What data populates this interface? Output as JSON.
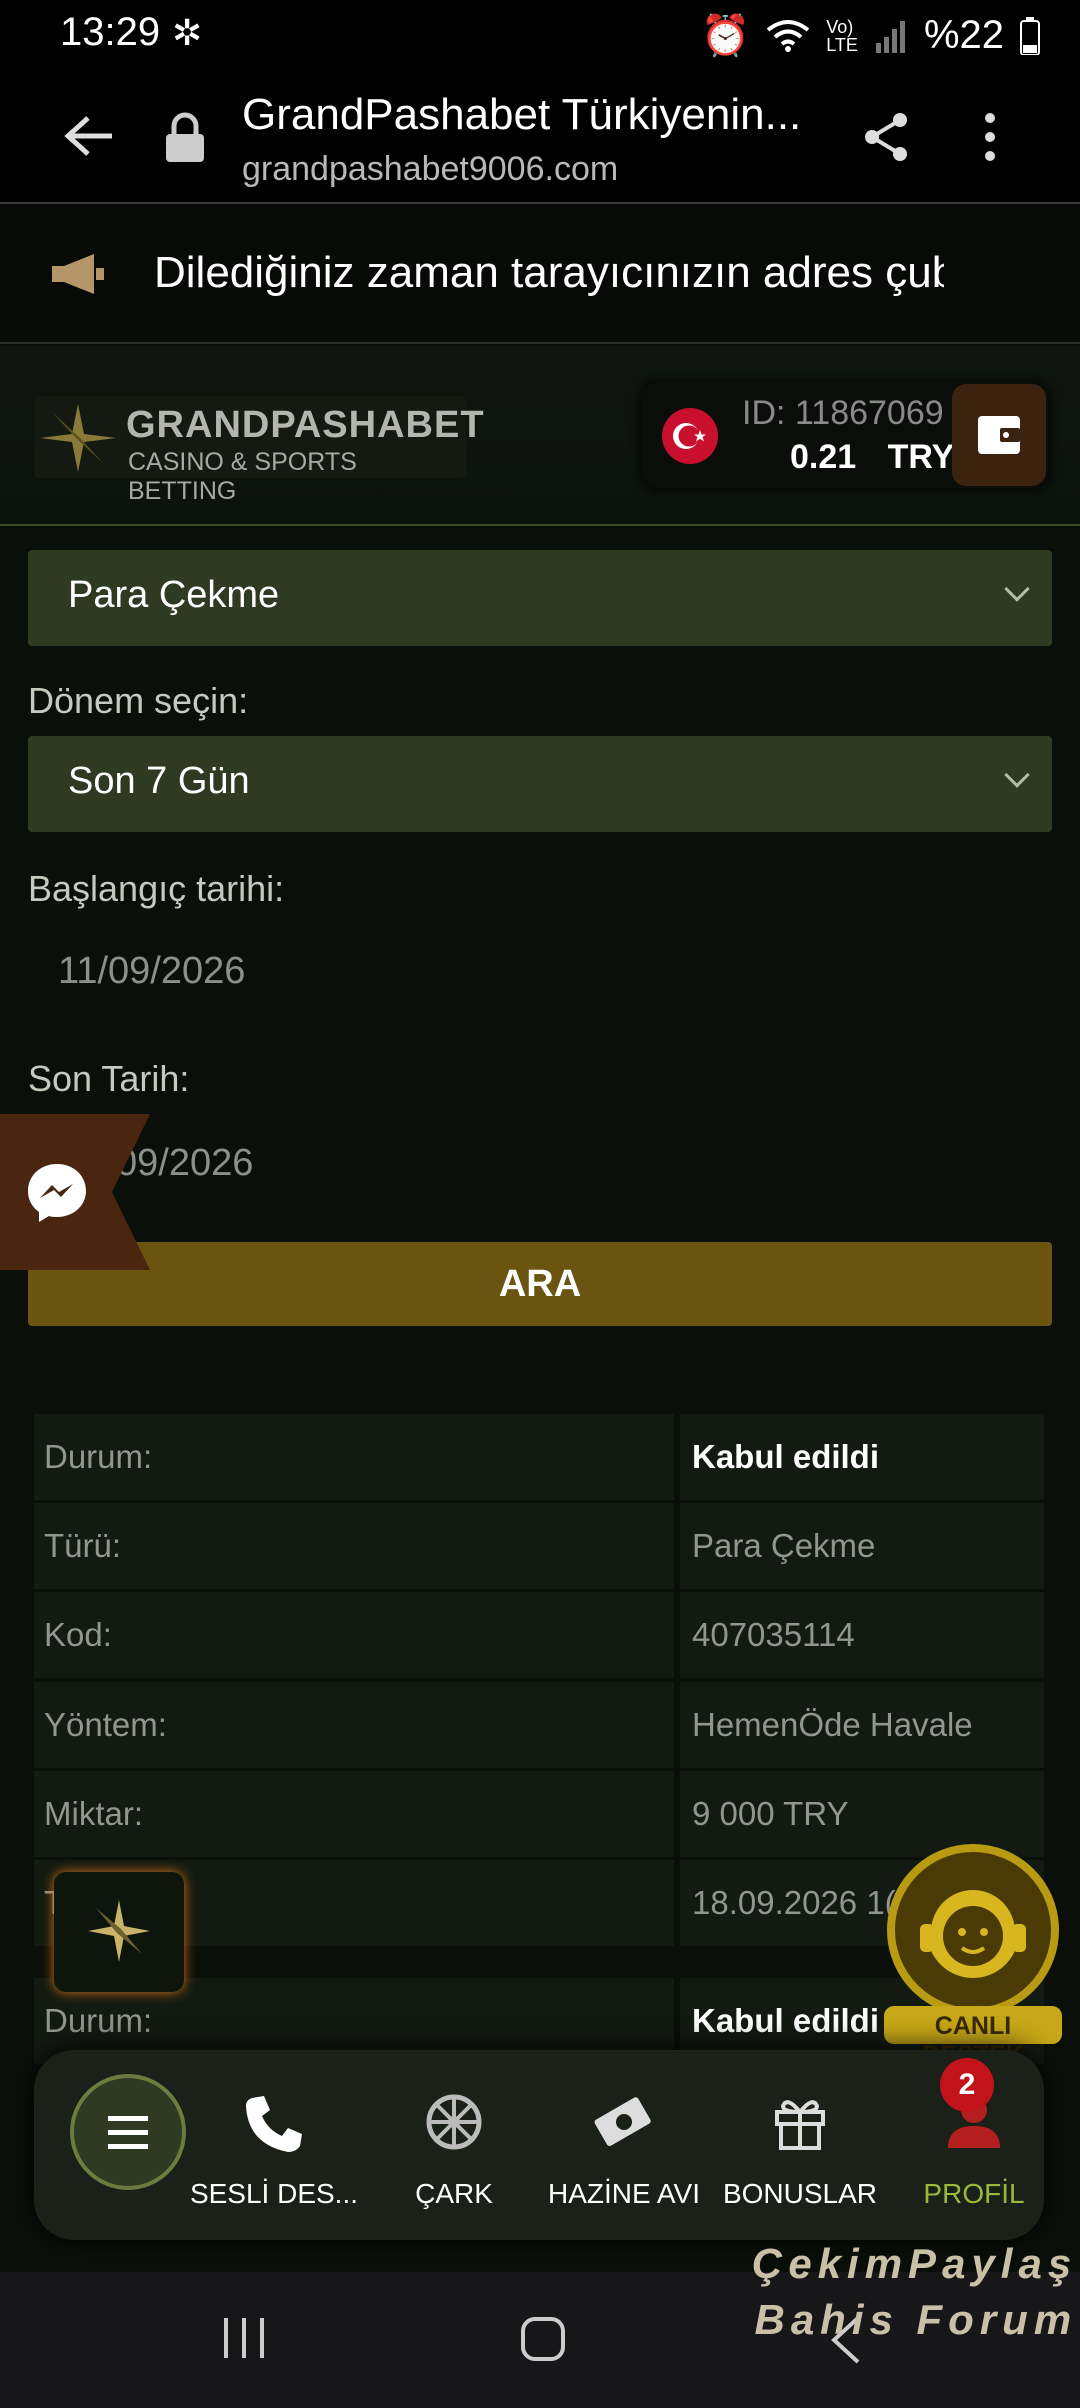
{
  "status_bar": {
    "time": "13:29",
    "battery": "%22"
  },
  "browser": {
    "title": "GrandPashabet Türkiyenin...",
    "url": "grandpashabet9006.com"
  },
  "notice": {
    "text": "Dilediğiniz zaman tarayıcınızın adres çubuğu"
  },
  "header": {
    "brand": "GRANDPASHABET",
    "tagline": "CASINO & SPORTS BETTING",
    "account_id": "ID: 11867069",
    "balance": "0.21 TRY"
  },
  "form": {
    "type_value": "Para Çekme",
    "period_label": "Dönem seçin:",
    "period_value": "Son 7 Gün",
    "start_label": "Başlangıç tarihi:",
    "start_value": "11/09/2026",
    "end_label": "Son Tarih:",
    "end_value": "09/2026",
    "search_button": "ARA"
  },
  "transactions": [
    {
      "label": "Durum:",
      "value": "Kabul edildi"
    },
    {
      "label": "Türü:",
      "value": "Para Çekme"
    },
    {
      "label": "Kod:",
      "value": "407035114"
    },
    {
      "label": "Yöntem:",
      "value": "HemenÖde Havale"
    },
    {
      "label": "Miktar:",
      "value": "9 000 TRY"
    },
    {
      "label": "T",
      "value": "18.09.2026 1("
    },
    {
      "label": "Durum:",
      "value": "Kabul edildi"
    }
  ],
  "live_support": "CANLI DESTEK",
  "bottom_nav": {
    "items": [
      "SESLİ DES...",
      "ÇARK",
      "HAZİNE AVI",
      "BONUSLAR",
      "PROFİL"
    ],
    "badge": "2",
    "active_color": "#9bb83a"
  },
  "watermark": {
    "line1": "ÇekimPaylaş",
    "line2": "Bahis Forum"
  }
}
